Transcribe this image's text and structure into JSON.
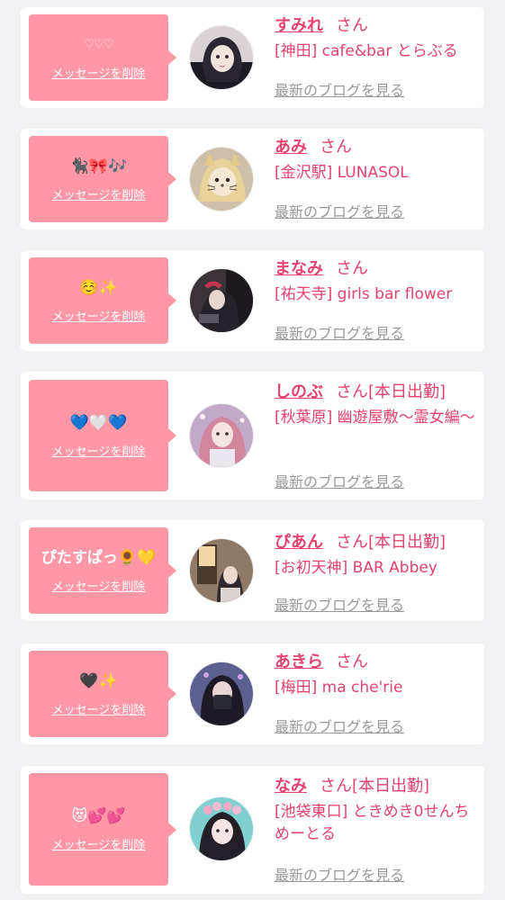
{
  "labels": {
    "delete": "メッセージを削除",
    "blog": "最新のブログを見る",
    "honorific": "さん"
  },
  "cards": [
    {
      "message": "♡♡♡",
      "name": "すみれ",
      "status": "",
      "shop": "[神田] cafe&bar とらぶる"
    },
    {
      "message": "🐈‍⬛🎀🎶",
      "name": "あみ",
      "status": "",
      "shop": "[金沢駅] LUNASOL"
    },
    {
      "message": "☺️✨",
      "name": "まなみ",
      "status": "",
      "shop": "[祐天寺] girls bar flower"
    },
    {
      "message": "💙🤍💙",
      "name": "しのぶ",
      "status": "[本日出勤]",
      "shop": "[秋葉原] 幽遊屋敷〜霊女編〜"
    },
    {
      "message": "ぴたすぱっ🌻💛",
      "name": "ぴあん",
      "status": "[本日出勤]",
      "shop": "[お初天神] BAR Abbey"
    },
    {
      "message": "🖤✨",
      "name": "あきら",
      "status": "",
      "shop": "[梅田] ma che'rie"
    },
    {
      "message": "😻💕💕",
      "name": "なみ",
      "status": "[本日出勤]",
      "shop": "[池袋東口] ときめき0せんちめーとる"
    }
  ],
  "colors": {
    "page_bg": "#f2f2f4",
    "card_bg": "#ffffff",
    "bubble_bg": "#ff97a6",
    "accent_pink": "#e5436e",
    "link_gray": "#999999"
  },
  "avatar_icons": [
    "profile-photo",
    "profile-photo",
    "profile-photo",
    "profile-photo",
    "profile-photo",
    "profile-photo",
    "profile-photo"
  ]
}
